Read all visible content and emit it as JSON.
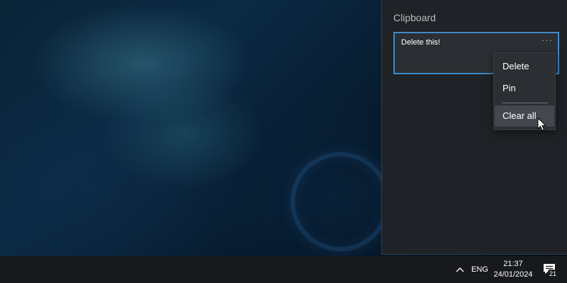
{
  "clipboard": {
    "title": "Clipboard",
    "items": [
      {
        "text": "Delete this!",
        "more_label": "···"
      }
    ]
  },
  "context_menu": {
    "items": [
      {
        "label": "Delete"
      },
      {
        "label": "Pin"
      },
      {
        "label": "Clear all"
      }
    ]
  },
  "taskbar": {
    "language": "ENG",
    "time": "21:37",
    "date": "24/01/2024",
    "notification_count": "21"
  },
  "colors": {
    "accent": "#3f88c8",
    "panel_bg": "#1f2226",
    "taskbar_bg": "#17191c"
  },
  "icons": {
    "more": "ellipsis-icon",
    "tray": "chevron-up-icon",
    "notifications": "action-center-icon",
    "cursor": "mouse-pointer-icon"
  }
}
